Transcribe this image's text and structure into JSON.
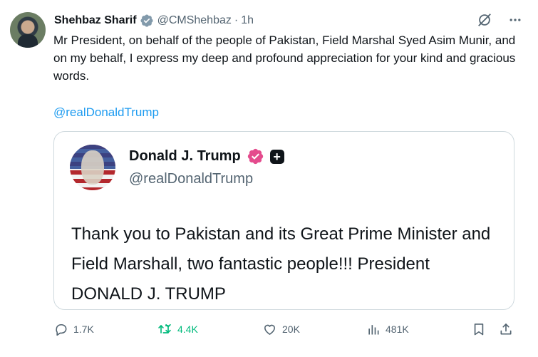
{
  "post": {
    "author_name": "Shehbaz Sharif",
    "author_handle": "@CMShehbaz",
    "separator": "·",
    "time": "1h",
    "text": "Mr President, on behalf of the people of Pakistan, Field Marshal Syed Asim Munir, and on my behalf, I express my deep and profound appreciation for your kind and gracious words.",
    "mention": "@realDonaldTrump"
  },
  "quote": {
    "author_name": "Donald J. Trump",
    "author_handle": "@realDonaldTrump",
    "plus_badge": "+",
    "text": "Thank you to Pakistan and its Great Prime Minister and Field Marshall, two fantastic people!!! President DONALD J. TRUMP"
  },
  "actions": {
    "replies": "1.7K",
    "reposts": "4.4K",
    "likes": "20K",
    "views": "481K"
  },
  "colors": {
    "accent": "#1d9bf0",
    "repost_active": "#00ba7c",
    "muted": "#536471",
    "text": "#0f1419",
    "verified_gray": "#829aab",
    "verified_pink": "#e44b8d"
  },
  "icons": {
    "verified": "verified-badge-icon",
    "grok": "grok-icon",
    "more": "more-icon",
    "reply": "reply-icon",
    "repost": "repost-icon",
    "like": "like-icon",
    "views": "views-icon",
    "bookmark": "bookmark-icon",
    "share": "share-icon"
  }
}
